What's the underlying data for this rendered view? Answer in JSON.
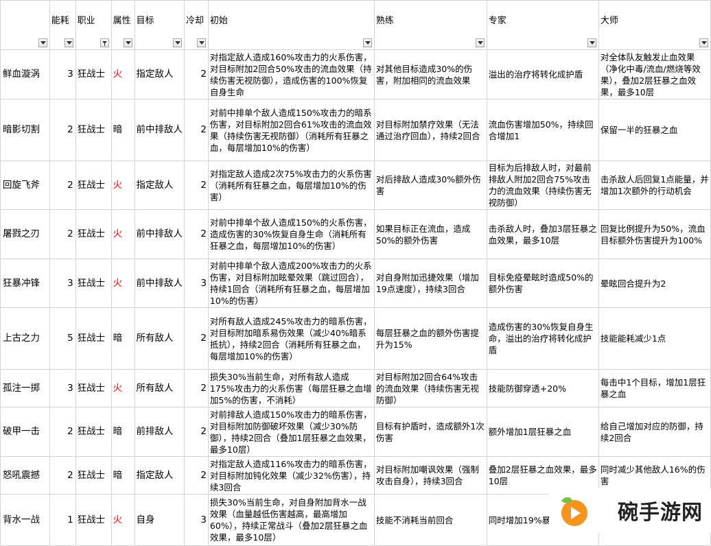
{
  "headers": {
    "name": "",
    "cost": "能耗",
    "job": "职业",
    "attr": "属性",
    "target": "目标",
    "cooldown": "冷却",
    "initial": "初始",
    "skilled": "熟练",
    "expert": "专家",
    "master": "大师"
  },
  "fire_color": "#ff0000",
  "rows": [
    {
      "name": "鲜血漩涡",
      "cost": "3",
      "job": "狂战士",
      "attr": "火",
      "target": "指定敌人",
      "cd": "2",
      "initial": "对指定敌人造成160%攻击力的火系伤害，对目标附加2回合50%攻击的流血效果（持续伤害无视防御），造成伤害的100%恢复自身生命",
      "skilled": "对其他目标造成30%的伤害，附加相同的流血效果",
      "expert": "溢出的治疗将转化成护盾",
      "master": "对全体队友触发止血效果（净化中毒/流血/燃烧等效果），叠加2层狂暴之血效果，最多10层"
    },
    {
      "name": "暗影切割",
      "cost": "2",
      "job": "狂战士",
      "attr": "暗",
      "target": "前中排敌人",
      "cd": "2",
      "initial": "对前中排单个敌人造成150%攻击力的暗系伤害，对目标附加2回合61%攻击的流血效果（持续伤害无视防御）（消耗所有狂暴之血，每层增加10%的伤害）",
      "skilled": "对目标附加禁疗效果（无法通过治疗回血），持续2回合",
      "expert": "流血伤害增加50%，持续回合增加1",
      "master": "保留一半的狂暴之血"
    },
    {
      "name": "回旋飞斧",
      "cost": "2",
      "job": "狂战士",
      "attr": "火",
      "target": "指定敌人",
      "cd": "2",
      "initial": "对指定敌人造成2次75%攻击力的火系伤害（消耗所有狂暴之血，每层增加10%的伤害）",
      "skilled": "对后排敌人造成30%额外伤害",
      "expert": "目标为后排敌人时，对最前排敌人附加2回合75%攻击力的流血效果（持续伤害无视防御）",
      "master": "击杀敌人后回复1点能量，并增加1次额外的行动机会"
    },
    {
      "name": "屠戮之刃",
      "cost": "2",
      "job": "狂战士",
      "attr": "火",
      "target": "前中排敌人",
      "cd": "2",
      "initial": "对前中排单个敌人造成150%的火系伤害，造成伤害的30%恢复自身生命（消耗所有狂暴之血，每层增加10%的伤害）",
      "skilled": "如果目标正在流血，造成50%的额外伤害",
      "expert": "击杀敌人时，叠加3层狂暴之血效果，最多10层",
      "master": "回复比例提升为50%，流血目标额外伤害提升为100%"
    },
    {
      "name": "狂暴冲锋",
      "cost": "3",
      "job": "狂战士",
      "attr": "火",
      "target": "前中排敌人",
      "cd": "3",
      "initial": "对前中排单个敌人造成200%攻击力的火系伤害，对目标附加眩晕效果（跳过回合），持续1回合（消耗所有狂暴之血，每层增加10%的伤害）",
      "skilled": "对自身附加迅捷效果（增加19点速度），持续3回合",
      "expert": "目标免疫晕眩时造成50%的额外伤害",
      "master": "晕眩回合提升为2"
    },
    {
      "name": "上古之力",
      "cost": "5",
      "job": "狂战士",
      "attr": "暗",
      "target": "所有敌人",
      "cd": "2",
      "initial": "对所有敌人造成245%攻击力的暗系伤害，对目标附加暗系易伤效果（减少40%暗系抵抗），持续2回合（消耗所有狂暴之血，每层增加10%的伤害）",
      "skilled": "每层狂暴之血的额外伤害提升为15%",
      "expert": "造成伤害的30%恢复自身生命，溢出的治疗将转化成护盾",
      "master": "技能能耗减少1点"
    },
    {
      "name": "孤注一掷",
      "cost": "3",
      "job": "狂战士",
      "attr": "火",
      "target": "所有敌人",
      "cd": "2",
      "initial": "损失30%当前生命，对所有敌人造成175%攻击力的火系伤害（每层狂暴之血增加5%的伤害，不消耗）",
      "skilled": "对目标附加2回合64%攻击的流血效果（持续伤害无视防御）",
      "expert": "技能防御穿透+20%",
      "master": "每击中1个目标，增加1层狂暴之血"
    },
    {
      "name": "破甲一击",
      "cost": "2",
      "job": "狂战士",
      "attr": "暗",
      "target": "前排敌人",
      "cd": "2",
      "initial": "对前排敌人造成150%攻击力的暗系伤害，对目标附加防御破坏效果（减少30%防御），持续2回合（叠加1层狂暴之血效果，最多10层）",
      "skilled": "目标有护盾时，造成额外1次伤害",
      "expert": "额外增加1层狂暴之血",
      "master": "给自己增加对应的防御，持续2回合"
    },
    {
      "name": "怒吼震撼",
      "cost": "2",
      "job": "狂战士",
      "attr": "暗",
      "target": "指定敌人",
      "cd": "2",
      "initial": "对指定敌人造成116%攻击力的暗系伤害，对目标附加钝化效果（减少32%伤害），持续3回合",
      "skilled": "对目标附加嘲讽效果（强制攻击自身），持续3回合",
      "expert": "叠加2层狂暴之血效果，最多10层",
      "master": "同时减少其他敌人16%的伤害"
    },
    {
      "name": "背水一战",
      "cost": "1",
      "job": "狂战士",
      "attr": "火",
      "target": "自身",
      "cd": "3",
      "initial": "损失30%当前生命，对自身附加背水一战效果（血量越低伤害越高，最高增加60%），持续正常战斗（叠加2层狂暴之血效果，最多10层）",
      "skilled": "技能不消耗当前回合",
      "expert": "同时增加19%暴",
      "master": ""
    }
  ],
  "watermark": {
    "text": "碗手游网",
    "icon": "play-leaf-logo",
    "colors": {
      "green": "#7ac143",
      "orange": "#f7941d"
    }
  }
}
